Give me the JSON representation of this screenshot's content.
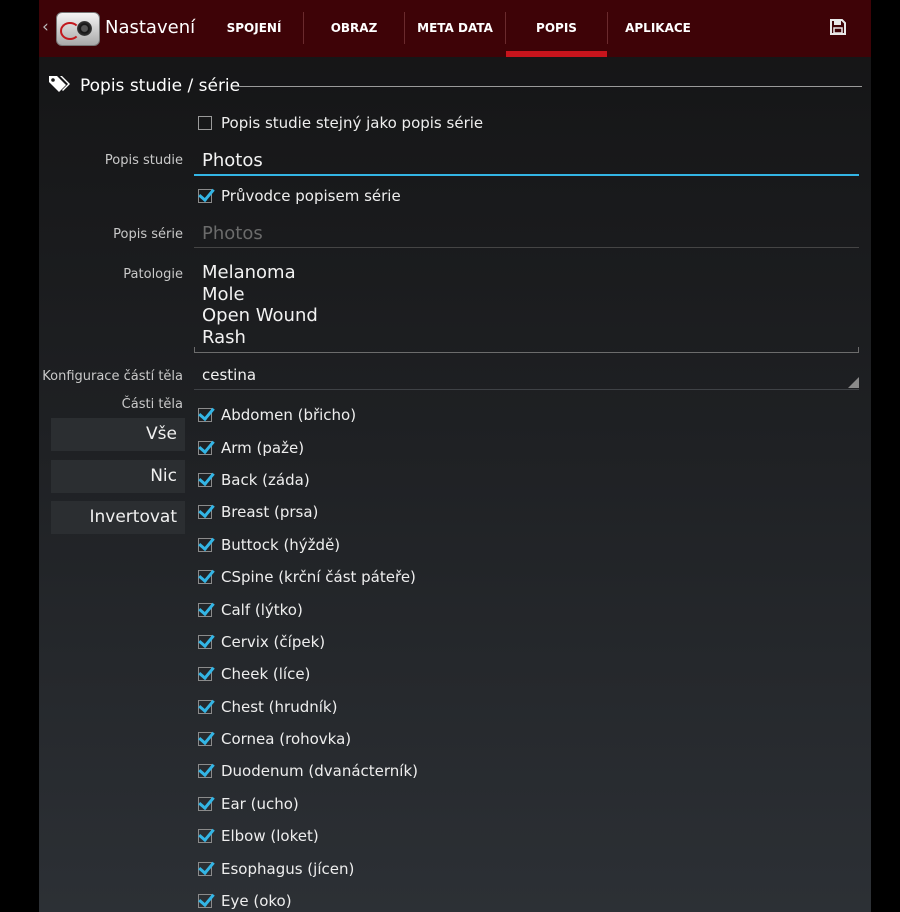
{
  "actionbar": {
    "title": "Nastavení",
    "tabs": [
      {
        "label": "SPOJENÍ"
      },
      {
        "label": "OBRAZ"
      },
      {
        "label": "META DATA"
      },
      {
        "label": "POPIS",
        "selected": true
      },
      {
        "label": "APLIKACE"
      }
    ],
    "save_icon": "save-icon",
    "accent": "#c8141c",
    "background": "#3e0307"
  },
  "section": {
    "title": "Popis studie / série",
    "icon": "tag-icon"
  },
  "form": {
    "same_description": {
      "label": "Popis studie stejný jako popis série",
      "checked": false
    },
    "study_description": {
      "label": "Popis studie",
      "value": "Photos"
    },
    "series_guide": {
      "label": "Průvodce popisem série",
      "checked": true
    },
    "series_description": {
      "label": "Popis série",
      "value": "Photos"
    },
    "pathology": {
      "label": "Patologie",
      "lines": [
        "Melanoma",
        "Mole",
        "Open Wound",
        "Rash"
      ]
    },
    "body_parts_config": {
      "label": "Konfigurace částí těla",
      "value": "cestina"
    },
    "body_parts": {
      "label": "Části těla",
      "buttons": {
        "all": "Vše",
        "none": "Nic",
        "invert": "Invertovat"
      },
      "items": [
        {
          "label": "Abdomen (břicho)",
          "checked": true
        },
        {
          "label": "Arm (paže)",
          "checked": true
        },
        {
          "label": "Back (záda)",
          "checked": true
        },
        {
          "label": "Breast (prsa)",
          "checked": true
        },
        {
          "label": "Buttock (hýždě)",
          "checked": true
        },
        {
          "label": "CSpine (krční část páteře)",
          "checked": true
        },
        {
          "label": "Calf (lýtko)",
          "checked": true
        },
        {
          "label": "Cervix (čípek)",
          "checked": true
        },
        {
          "label": "Cheek (líce)",
          "checked": true
        },
        {
          "label": "Chest (hrudník)",
          "checked": true
        },
        {
          "label": "Cornea (rohovka)",
          "checked": true
        },
        {
          "label": "Duodenum (dvanácterník)",
          "checked": true
        },
        {
          "label": "Ear (ucho)",
          "checked": true
        },
        {
          "label": "Elbow (loket)",
          "checked": true
        },
        {
          "label": "Esophagus (jícen)",
          "checked": true
        },
        {
          "label": "Eye (oko)",
          "checked": true
        }
      ]
    },
    "check_color": "#33b5e5"
  }
}
